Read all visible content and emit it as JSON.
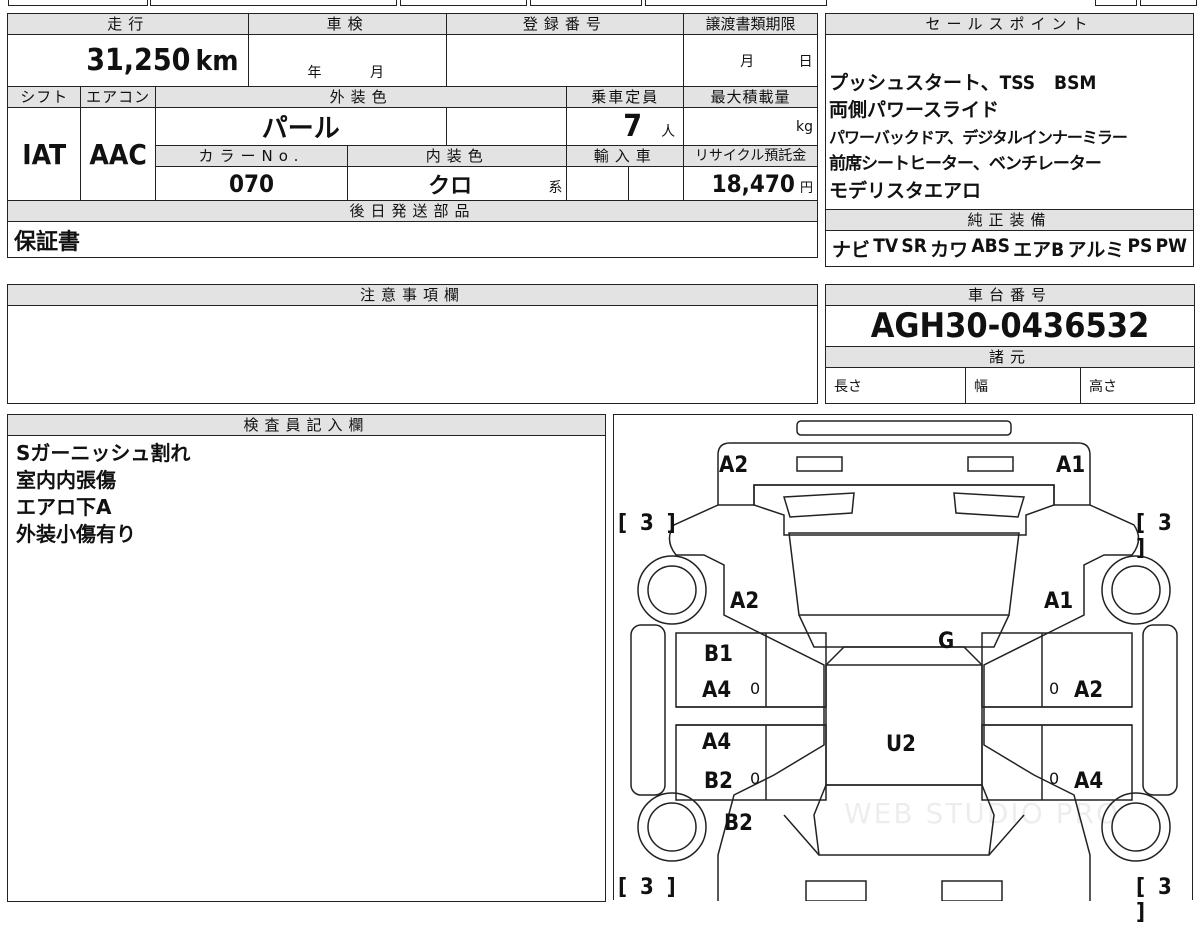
{
  "vehicle_info": {
    "headers": {
      "mileage": "走行",
      "inspection": "車検",
      "registration": "登録番号",
      "transfer_deadline": "譲渡書類期限",
      "shift": "シフト",
      "aircon": "エアコン",
      "exterior_color": "外装色",
      "capacity": "乗車定員",
      "max_load": "最大積載量",
      "color_no": "カラーNo.",
      "interior_color": "内装色",
      "import": "輸入車",
      "recycle_fee": "リサイクル預託金",
      "later_parts": "後日発送部品",
      "notes": "注意事項欄"
    },
    "mileage": "31,250",
    "mileage_unit": "km",
    "inspection_year": "年",
    "inspection_month": "月",
    "deadline_month": "月",
    "deadline_day": "日",
    "shift": "IAT",
    "aircon": "AAC",
    "exterior_color": "パール",
    "capacity": "7",
    "capacity_unit": "人",
    "max_load_unit": "kg",
    "color_no": "070",
    "interior_color": "クロ",
    "interior_color_suffix": "系",
    "recycle_fee": "18,470",
    "recycle_unit": "円",
    "later_parts": "保証書"
  },
  "sales_points": {
    "header": "セールスポイント",
    "lines": [
      "プッシュスタート、TSS　BSM",
      "両側パワースライド",
      "パワーバックドア、デジタルインナーミラー",
      "前席シートヒーター、ベンチレーター",
      "モデリスタエアロ"
    ]
  },
  "equipment": {
    "header": "純正装備",
    "items": [
      "ナビ",
      "TV",
      "SR",
      "カワ",
      "ABS",
      "エアB",
      "アルミ",
      "PS",
      "PW"
    ]
  },
  "chassis": {
    "header": "車台番号",
    "number": "AGH30-0436532",
    "spec_header": "諸元",
    "length": "長さ",
    "width": "幅",
    "height": "高さ"
  },
  "inspector": {
    "header": "検査員記入欄",
    "notes": [
      "Sガーニッシュ割れ",
      "室内内張傷",
      "エアロ下A",
      "外装小傷有り"
    ]
  },
  "diagram": {
    "labels": {
      "front_left_top": "A2",
      "front_right_top": "A1",
      "left_fender": "A2",
      "right_fender": "A1",
      "glass": "G",
      "left_door1_a": "B1",
      "left_door1_b": "A4",
      "right_door1": "A2",
      "left_door2_a": "A4",
      "left_door2_b": "B2",
      "right_door2": "A4",
      "left_rear": "B2",
      "roof": "U2",
      "zero": "0"
    },
    "tire": "3",
    "bracket_open": "[",
    "bracket_close": "]",
    "watermark": "WEB STUDIO PRO"
  }
}
